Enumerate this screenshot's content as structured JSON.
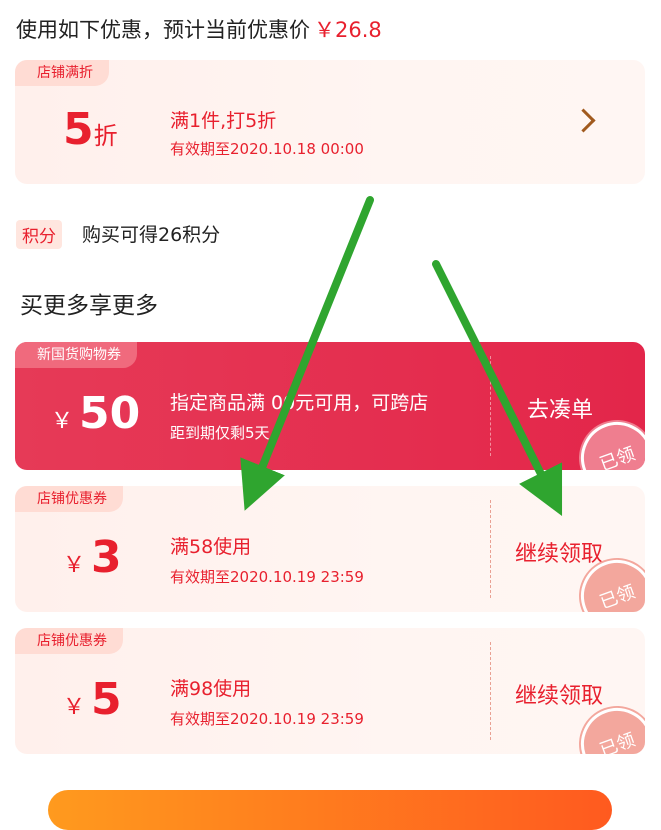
{
  "header": {
    "text": "使用如下优惠，预计当前优惠价",
    "price": "￥26.8"
  },
  "discount": {
    "tag": "店铺满折",
    "amount": "5",
    "unit": "折",
    "title": "满1件,打5折",
    "validity": "有效期至2020.10.18 00:00"
  },
  "points": {
    "badge": "积分",
    "text": "购买可得26积分"
  },
  "section_title": "买更多享更多",
  "coupons": [
    {
      "tag": "新国货购物券",
      "yen": "￥",
      "amount": "50",
      "title": "指定商品满 00元可用，可跨店",
      "subtitle": "距到期仅剩5天",
      "action": "去凑单",
      "stamp": "已领"
    },
    {
      "tag": "店铺优惠券",
      "yen": "￥",
      "amount": "3",
      "title": "满58使用",
      "subtitle": "有效期至2020.10.19 23:59",
      "action": "继续领取",
      "stamp": "已领"
    },
    {
      "tag": "店铺优惠券",
      "yen": "￥",
      "amount": "5",
      "title": "满98使用",
      "subtitle": "有效期至2020.10.19 23:59",
      "action": "继续领取",
      "stamp": "已领"
    }
  ],
  "colors": {
    "accent": "#e8202e",
    "red_card": "#e3264a",
    "arrow": "#2fa52f",
    "bottom_bar": "#ff7a1e"
  }
}
